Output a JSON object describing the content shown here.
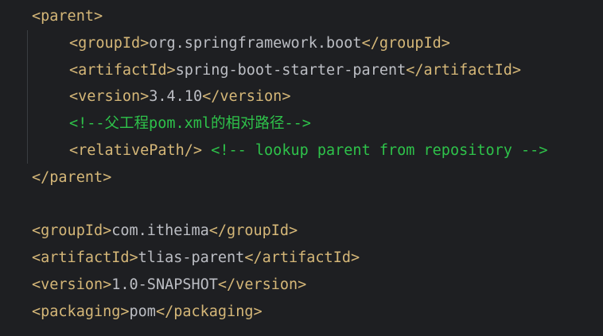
{
  "editor": {
    "lines": [
      {
        "indent": 0,
        "parts": [
          {
            "k": "tag",
            "t": "<parent>"
          }
        ]
      },
      {
        "indent": 1,
        "parts": [
          {
            "k": "tag",
            "t": "<groupId>"
          },
          {
            "k": "txt",
            "t": "org.springframework.boot"
          },
          {
            "k": "tag",
            "t": "</groupId>"
          }
        ]
      },
      {
        "indent": 1,
        "parts": [
          {
            "k": "tag",
            "t": "<artifactId>"
          },
          {
            "k": "txt",
            "t": "spring-boot-starter-parent"
          },
          {
            "k": "tag",
            "t": "</artifactId>"
          }
        ]
      },
      {
        "indent": 1,
        "parts": [
          {
            "k": "tag",
            "t": "<version>"
          },
          {
            "k": "txt",
            "t": "3.4.10"
          },
          {
            "k": "tag",
            "t": "</version>"
          }
        ]
      },
      {
        "indent": 1,
        "parts": [
          {
            "k": "cmt",
            "t": "<!--父工程pom.xml的相对路径-->"
          }
        ]
      },
      {
        "indent": 1,
        "parts": [
          {
            "k": "tag",
            "t": "<relativePath/>"
          },
          {
            "k": "txt",
            "t": " "
          },
          {
            "k": "cmt",
            "t": "<!-- lookup parent from repository -->"
          }
        ]
      },
      {
        "indent": 0,
        "parts": [
          {
            "k": "tag",
            "t": "</parent>"
          }
        ]
      },
      {
        "indent": 0,
        "parts": []
      },
      {
        "indent": 0,
        "parts": [
          {
            "k": "tag",
            "t": "<groupId>"
          },
          {
            "k": "txt",
            "t": "com.itheima"
          },
          {
            "k": "tag",
            "t": "</groupId>"
          }
        ]
      },
      {
        "indent": 0,
        "parts": [
          {
            "k": "tag",
            "t": "<artifactId>"
          },
          {
            "k": "txt",
            "t": "tlias-parent"
          },
          {
            "k": "tag",
            "t": "</artifactId>"
          }
        ]
      },
      {
        "indent": 0,
        "parts": [
          {
            "k": "tag",
            "t": "<version>"
          },
          {
            "k": "txt",
            "t": "1.0-SNAPSHOT"
          },
          {
            "k": "tag",
            "t": "</version>"
          }
        ]
      },
      {
        "indent": 0,
        "parts": [
          {
            "k": "tag",
            "t": "<packaging>"
          },
          {
            "k": "txt",
            "t": "pom"
          },
          {
            "k": "tag",
            "t": "</packaging>"
          }
        ]
      }
    ]
  },
  "colors": {
    "background": "#1e1f22",
    "tag": "#d5b778",
    "text": "#bcbec4",
    "comment": "#2ec24a",
    "indent_guide": "#3a3d41"
  }
}
